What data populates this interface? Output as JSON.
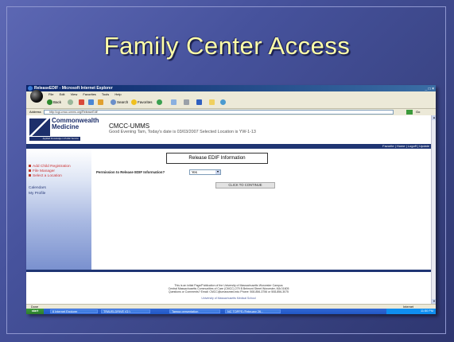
{
  "slide": {
    "title": "Family Center Access"
  },
  "browser": {
    "window_title": "ReleaseEDIF - Microsoft Internet Explorer",
    "menu": [
      "File",
      "Edit",
      "View",
      "Favorites",
      "Tools",
      "Help"
    ],
    "toolbar": {
      "back_label": "Back",
      "search_label": "Search",
      "favorites_label": "Favorites"
    },
    "address_label": "Address",
    "address_value": "http://cgi-cmcc.umms.org/ReleaseEdif",
    "links_label": "Go",
    "status_text": "Done",
    "zone_text": "Internet"
  },
  "page": {
    "logo_line1": "Commonwealth",
    "logo_line2": "Medicine",
    "logo_tagline": "Applied Knowledge in Public Service",
    "app_name": "CMCC-UMMS",
    "greeting": "Good Evening Tam, Today's date is 03/03/2007 Selected Location is YW-1-13",
    "nav_links": "Favorite | Home | Logoff | Update",
    "sidebar": {
      "links": [
        "Add Child Registration",
        "File Manager",
        "Select a Location"
      ],
      "sub_links": [
        "Calendars",
        "My Profile"
      ]
    },
    "release_heading": "Release EDIF Information",
    "permission_label": "Permission to Release EDIF Information?",
    "permission_value": "Yes",
    "continue_label": "CLICK TO CONTINUE",
    "footer": {
      "line1": "This is an initial Page/Publication of the University of Massachusetts Worcester Campus",
      "line2": "Central Massachusetts Communities of Care (CMCC)   279 B Belmont Street Worcester, MA 01605",
      "line3": "Questions or Comments? Email: CMCC@umassmed.edu  Phone: 508-856-3756 or 508-856-3075",
      "line4": "University of Massachusetts Medical School"
    }
  },
  "taskbar": {
    "start_label": "start",
    "tasks": [
      "6 Internet Explorer",
      "TRAVELDRIVE (G:)",
      "Tampa presentation",
      "NC TOPPS (February 26..."
    ],
    "clock": "11:50 PM"
  },
  "colors": {
    "slide_background": "#46529c",
    "title_text": "#ffffa8",
    "brand_navy": "#1f3573",
    "sidebar_link": "#cc3333"
  }
}
